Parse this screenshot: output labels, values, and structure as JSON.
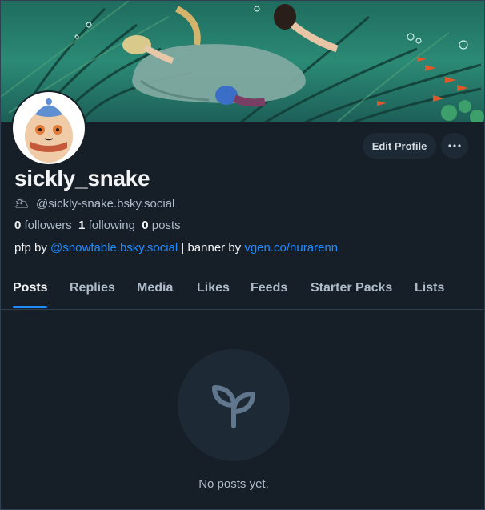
{
  "profile": {
    "display_name": "sickly_snake",
    "handle_emoji": "🌥",
    "handle": "@sickly-snake.bsky.social",
    "followers_count": "0",
    "followers_label": "followers",
    "following_count": "1",
    "following_label": "following",
    "posts_count": "0",
    "posts_label": "posts"
  },
  "bio": {
    "prefix": "pfp by ",
    "link1": "@snowfable.bsky.social",
    "separator": " | banner by ",
    "link2": "vgen.co/nurarenn"
  },
  "actions": {
    "edit_profile": "Edit Profile",
    "more": "···"
  },
  "tabs": [
    "Posts",
    "Replies",
    "Media",
    "Likes",
    "Feeds",
    "Starter Packs",
    "Lists"
  ],
  "active_tab": "Posts",
  "empty_state": {
    "icon": "seedling-icon",
    "text": "No posts yet."
  },
  "colors": {
    "background": "#161e27",
    "accent": "#208bfe",
    "muted_text": "#aebbc9"
  }
}
